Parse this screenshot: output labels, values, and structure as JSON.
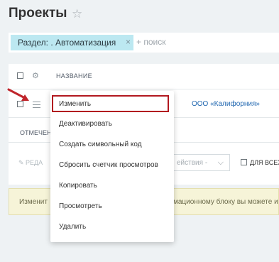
{
  "header": {
    "title": "Проекты",
    "star_icon": "star-icon"
  },
  "filter": {
    "chip_label": "Раздел: . Автоматизация",
    "chip_remove": "×",
    "search_placeholder": "+ поиск"
  },
  "grid": {
    "column_name": "НАЗВАНИЕ",
    "row_name": "ООО «Калифорния»",
    "selected_label": "ОТМЕЧЕН",
    "edit_label": "✎ РЕДА",
    "actions_select": "ействия -",
    "all_label": "ДЛЯ ВСЕХ"
  },
  "notice": {
    "left": "Изменит",
    "right": "мационному блоку вы можете и"
  },
  "menu": {
    "items": [
      "Изменить",
      "Деактивировать",
      "Создать символьный код",
      "Сбросить счетчик просмотров",
      "Копировать",
      "Просмотреть",
      "Удалить"
    ]
  },
  "colors": {
    "accent_link": "#2067b0",
    "chip_bg": "#bce8f1",
    "highlight": "#b2181f",
    "arrow": "#c0262c"
  }
}
